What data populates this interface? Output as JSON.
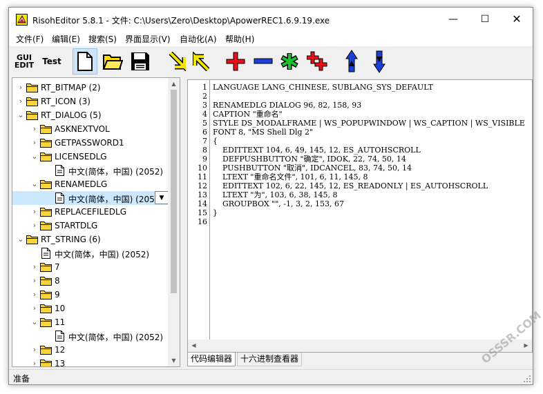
{
  "window": {
    "title": "RisohEditor 5.8.1 - 文件: C:\\Users\\Zero\\Desktop\\ApowerREC1.6.9.19.exe",
    "controls": {
      "minimize": "—",
      "maximize": "☐",
      "close": "✕"
    }
  },
  "menu": [
    {
      "label": "文件(F)"
    },
    {
      "label": "编辑(E)"
    },
    {
      "label": "搜索(S)"
    },
    {
      "label": "界面显示(V)"
    },
    {
      "label": "自动化(A)"
    },
    {
      "label": "帮助(H)"
    }
  ],
  "toolbar": {
    "gui_edit_label": "GUI\nEDIT",
    "test_label": "Test",
    "icons": [
      "new-file-icon",
      "open-folder-icon",
      "save-disk-icon",
      "arrow-down-right-icon",
      "arrow-up-left-icon",
      "add-plus-icon",
      "delete-minus-icon",
      "modify-asterisk-icon",
      "clone-plus-icon",
      "move-up-icon",
      "move-down-icon"
    ],
    "accent_yellow": "#f2e600",
    "accent_red": "#e8101a",
    "accent_blue": "#1c3fd6",
    "accent_green": "#19c430"
  },
  "tree": [
    {
      "label": "RT_BITMAP (2)",
      "expander": "›",
      "type": "folder",
      "indent": 0
    },
    {
      "label": "RT_ICON (3)",
      "expander": "›",
      "type": "folder",
      "indent": 0
    },
    {
      "label": "RT_DIALOG (5)",
      "expander": "⌄",
      "type": "folder",
      "indent": 0
    },
    {
      "label": "ASKNEXTVOL",
      "expander": "›",
      "type": "folder",
      "indent": 1
    },
    {
      "label": "GETPASSWORD1",
      "expander": "›",
      "type": "folder",
      "indent": 1
    },
    {
      "label": "LICENSEDLG",
      "expander": "⌄",
      "type": "folder",
      "indent": 1
    },
    {
      "label": "中文(简体，中国) (2052)",
      "expander": "",
      "type": "doc",
      "indent": 2
    },
    {
      "label": "RENAMEDLG",
      "expander": "⌄",
      "type": "folder",
      "indent": 1
    },
    {
      "label": "中文(简体，中国) (2052",
      "expander": "",
      "type": "doc",
      "indent": 2,
      "selected": true
    },
    {
      "label": "REPLACEFILEDLG",
      "expander": "›",
      "type": "folder",
      "indent": 1
    },
    {
      "label": "STARTDLG",
      "expander": "›",
      "type": "folder",
      "indent": 1
    },
    {
      "label": "RT_STRING (6)",
      "expander": "⌄",
      "type": "folder",
      "indent": 0
    },
    {
      "label": "中文(简体，中国) (2052)",
      "expander": "",
      "type": "doc",
      "indent": 1
    },
    {
      "label": "7",
      "expander": "›",
      "type": "folder",
      "indent": 1
    },
    {
      "label": "8",
      "expander": "›",
      "type": "folder",
      "indent": 1
    },
    {
      "label": "9",
      "expander": "›",
      "type": "folder",
      "indent": 1
    },
    {
      "label": "10",
      "expander": "›",
      "type": "folder",
      "indent": 1
    },
    {
      "label": "11",
      "expander": "⌄",
      "type": "folder",
      "indent": 1
    },
    {
      "label": "中文(简体，中国) (2052)",
      "expander": "",
      "type": "doc",
      "indent": 2
    },
    {
      "label": "12",
      "expander": "›",
      "type": "folder",
      "indent": 1
    },
    {
      "label": "13",
      "expander": "›",
      "type": "folder",
      "indent": 1
    }
  ],
  "editor": {
    "lines": [
      {
        "n": "1",
        "text": "LANGUAGE LANG_CHINESE, SUBLANG_SYS_DEFAULT"
      },
      {
        "n": "2",
        "text": ""
      },
      {
        "n": "3",
        "text": "RENAMEDLG DIALOG 96, 82, 158, 93"
      },
      {
        "n": "4",
        "text": "CAPTION \"重命名\""
      },
      {
        "n": "5",
        "text": "STYLE DS_MODALFRAME | WS_POPUPWINDOW | WS_CAPTION | WS_VISIBLE"
      },
      {
        "n": "6",
        "text": "FONT 8, \"MS Shell Dlg 2\""
      },
      {
        "n": "7",
        "text": "{"
      },
      {
        "n": "8",
        "text": "    EDITTEXT 104, 6, 49, 145, 12, ES_AUTOHSCROLL"
      },
      {
        "n": "9",
        "text": "    DEFPUSHBUTTON \"确定\", IDOK, 22, 74, 50, 14"
      },
      {
        "n": "10",
        "text": "    PUSHBUTTON \"取消\", IDCANCEL, 83, 74, 50, 14"
      },
      {
        "n": "11",
        "text": "    LTEXT \"重命名文件\", 101, 6, 11, 145, 8"
      },
      {
        "n": "12",
        "text": "    EDITTEXT 102, 6, 22, 145, 12, ES_READONLY | ES_AUTOHSCROLL"
      },
      {
        "n": "13",
        "text": "    LTEXT \"为\", 103, 6, 38, 145, 8"
      },
      {
        "n": "14",
        "text": "    GROUPBOX \"\", -1, 3, 2, 153, 67"
      },
      {
        "n": "15",
        "text": "}"
      },
      {
        "n": "16",
        "text": ""
      }
    ]
  },
  "tabs": [
    {
      "label": "代码编辑器",
      "active": true
    },
    {
      "label": "十六进制查看器",
      "active": false
    }
  ],
  "status": {
    "text": "准备"
  },
  "watermark": {
    "text": "OSSSR.COM"
  }
}
